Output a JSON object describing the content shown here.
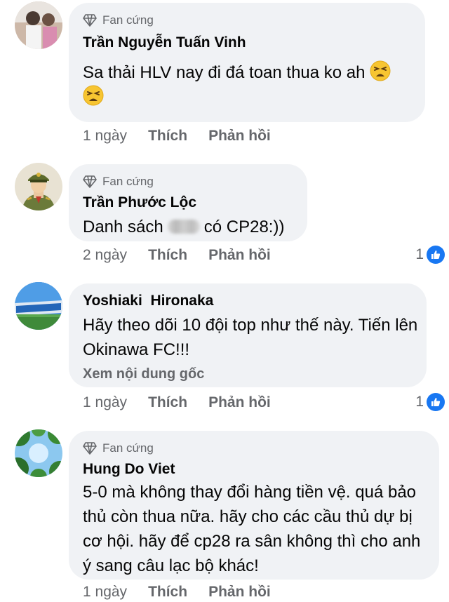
{
  "comments": [
    {
      "badge": "Fan cứng",
      "author": "Trần Nguyễn Tuấn Vinh",
      "text": "Sa thải HLV nay đi đá toan thua ko ah",
      "time": "1 ngày",
      "like": "Thích",
      "reply": "Phản hồi",
      "emoji": "tired-face-emoji"
    },
    {
      "badge": "Fan cứng",
      "author": "Trần Phước Lộc",
      "text_before": "Danh sách",
      "text_after": "có CP28:))",
      "time": "2 ngày",
      "like": "Thích",
      "reply": "Phản hồi",
      "reaction_count": "1"
    },
    {
      "author": "Yoshiaki  Hironaka",
      "text": "Hãy theo dõi 10 đội top như thế này. Tiến lên Okinawa FC!!!",
      "see_original": "Xem nội dung gốc",
      "time": "1 ngày",
      "like": "Thích",
      "reply": "Phản hồi",
      "reaction_count": "1"
    },
    {
      "badge": "Fan cứng",
      "author": "Hung Do Viet",
      "text": "5-0 mà không thay đổi hàng tiền vệ. quá bảo thủ còn thua nữa. hãy cho các cầu thủ dự bị cơ hội. hãy để cp28 ra sân không thì cho anh ý sang câu lạc bộ khác!",
      "time": "1 ngày",
      "like": "Thích",
      "reply": "Phản hồi"
    }
  ],
  "colors": {
    "bubble": "#f0f2f5",
    "secondary_text": "#65676b",
    "like_blue": "#1877f2"
  }
}
